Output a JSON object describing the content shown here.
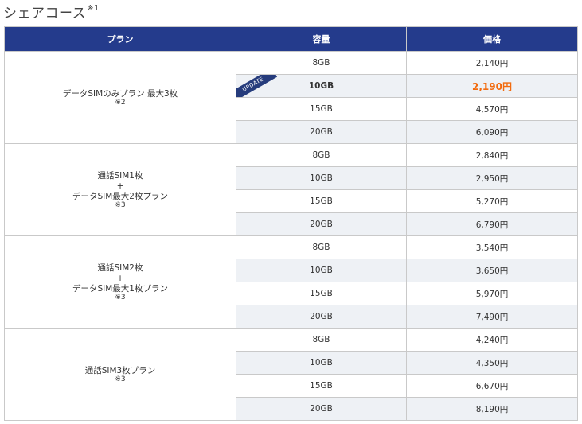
{
  "title": "シェアコース",
  "title_note": "※1",
  "headers": {
    "plan": "プラン",
    "capacity": "容量",
    "price": "価格"
  },
  "update_badge": "UPDATE",
  "plans": [
    {
      "lines": [
        "データSIMのみプラン 最大3枚"
      ],
      "note": "※2",
      "rows": [
        {
          "cap": "8GB",
          "price": "2,140円"
        },
        {
          "cap": "10GB",
          "price": "2,190円",
          "update": true
        },
        {
          "cap": "15GB",
          "price": "4,570円"
        },
        {
          "cap": "20GB",
          "price": "6,090円"
        }
      ]
    },
    {
      "lines": [
        "通話SIM1枚",
        "+",
        "データSIM最大2枚プラン"
      ],
      "note": "※3",
      "rows": [
        {
          "cap": "8GB",
          "price": "2,840円"
        },
        {
          "cap": "10GB",
          "price": "2,950円"
        },
        {
          "cap": "15GB",
          "price": "5,270円"
        },
        {
          "cap": "20GB",
          "price": "6,790円"
        }
      ]
    },
    {
      "lines": [
        "通話SIM2枚",
        "+",
        "データSIM最大1枚プラン"
      ],
      "note": "※3",
      "rows": [
        {
          "cap": "8GB",
          "price": "3,540円"
        },
        {
          "cap": "10GB",
          "price": "3,650円"
        },
        {
          "cap": "15GB",
          "price": "5,970円"
        },
        {
          "cap": "20GB",
          "price": "7,490円"
        }
      ]
    },
    {
      "lines": [
        "通話SIM3枚プラン"
      ],
      "note": "※3",
      "rows": [
        {
          "cap": "8GB",
          "price": "4,240円"
        },
        {
          "cap": "10GB",
          "price": "4,350円"
        },
        {
          "cap": "15GB",
          "price": "6,670円"
        },
        {
          "cap": "20GB",
          "price": "8,190円"
        }
      ]
    }
  ],
  "colors": {
    "header_bg": "#243b8c",
    "highlight_price": "#f26b0f",
    "alt_row": "#eef1f5"
  }
}
